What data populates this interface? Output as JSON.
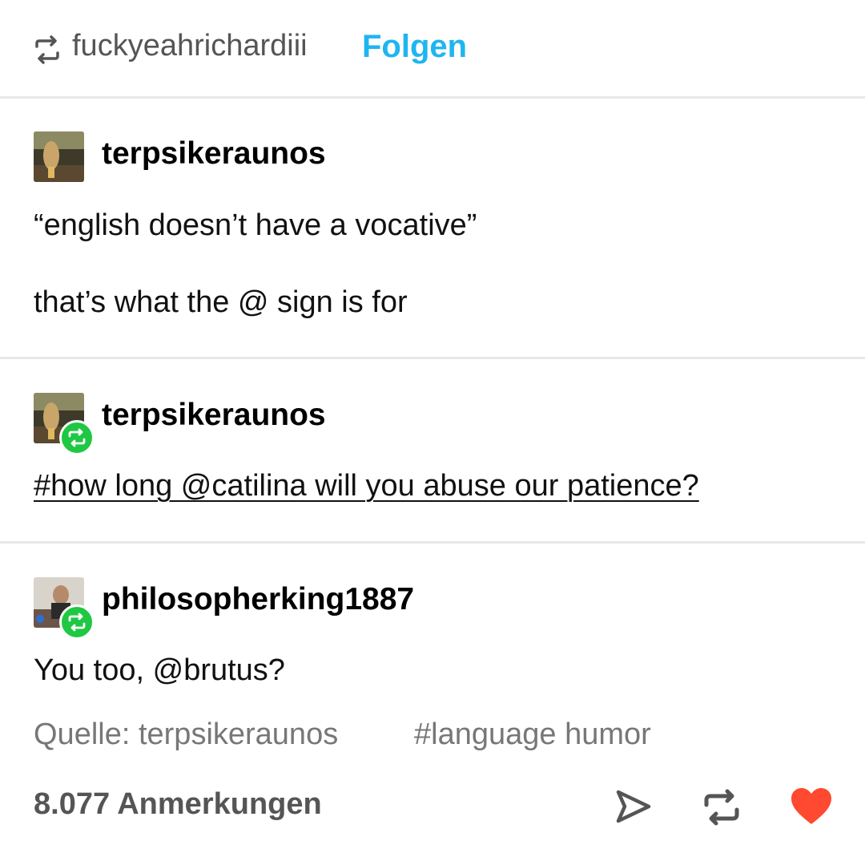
{
  "header": {
    "reblogged_from": "fuckyeahrichardiii",
    "follow_label": "Folgen"
  },
  "posts": [
    {
      "username": "terpsikeraunos",
      "paragraphs": [
        "“english doesn’t have a vocative”",
        "that’s what the @ sign is for"
      ]
    },
    {
      "username": "terpsikeraunos",
      "tag_line": "#how long @catilina will you abuse our patience?"
    },
    {
      "username": "philosopherking1887",
      "paragraphs": [
        "You too, @brutus?"
      ]
    }
  ],
  "footer": {
    "source": "Quelle: terpsikeraunos",
    "tag": "#language humor",
    "notes": "8.077 Anmerkungen"
  },
  "colors": {
    "follow": "#1fb5f0",
    "reblog_badge": "#1ec843",
    "like": "#ff4930",
    "muted": "#777777"
  },
  "icons": [
    "reblog-icon",
    "share-icon",
    "like-icon"
  ]
}
